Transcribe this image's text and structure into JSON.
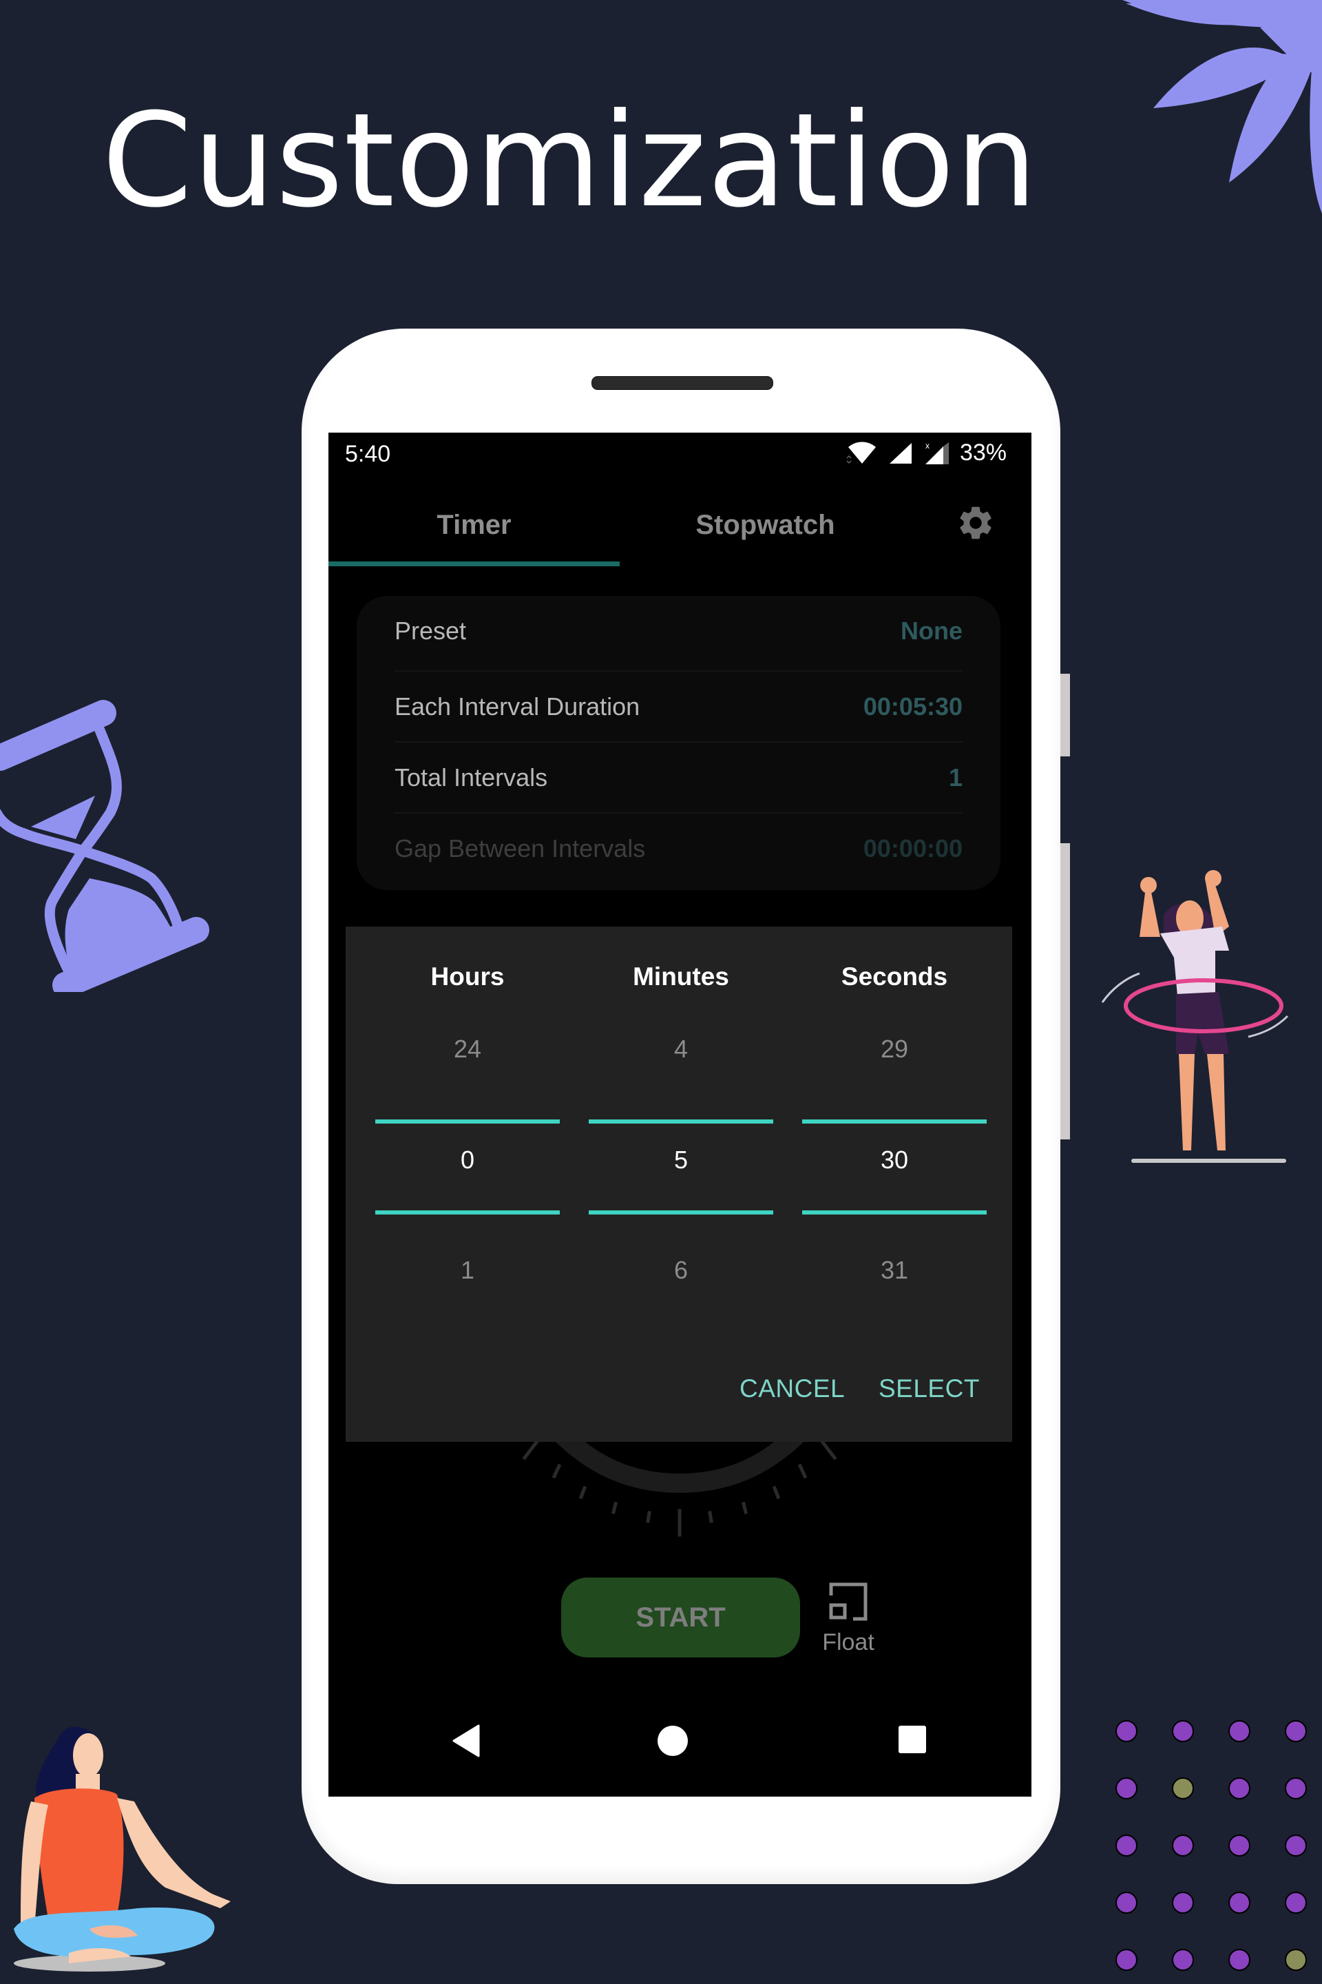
{
  "headline": "Customization",
  "status_bar": {
    "time": "5:40",
    "battery": "33%",
    "icons": [
      "wifi-icon",
      "signal-icon",
      "signal-roaming-icon"
    ]
  },
  "tabs": [
    {
      "label": "Timer",
      "active": true
    },
    {
      "label": "Stopwatch",
      "active": false
    }
  ],
  "settings_icon": "gear-icon",
  "settings": [
    {
      "label": "Preset",
      "value": "None",
      "enabled": true
    },
    {
      "label": "Each Interval Duration",
      "value": "00:05:30",
      "enabled": true
    },
    {
      "label": "Total Intervals",
      "value": "1",
      "enabled": true
    },
    {
      "label": "Gap Between Intervals",
      "value": "00:00:00",
      "enabled": false
    }
  ],
  "picker": {
    "columns": [
      {
        "label": "Hours",
        "prev": "24",
        "current": "0",
        "next": "1"
      },
      {
        "label": "Minutes",
        "prev": "4",
        "current": "5",
        "next": "6"
      },
      {
        "label": "Seconds",
        "prev": "29",
        "current": "30",
        "next": "31"
      }
    ],
    "cancel_label": "CANCEL",
    "select_label": "SELECT"
  },
  "start_label": "START",
  "float_label": "Float",
  "colors": {
    "background": "#1b2130",
    "accent_teal": "#3fd4c2",
    "tab_indicator": "#1a6b66",
    "start_button": "#214a1f",
    "illustration_purple": "#9192f0",
    "dot_purple": "#8a42c0",
    "dot_olive": "#8a8f5a"
  }
}
